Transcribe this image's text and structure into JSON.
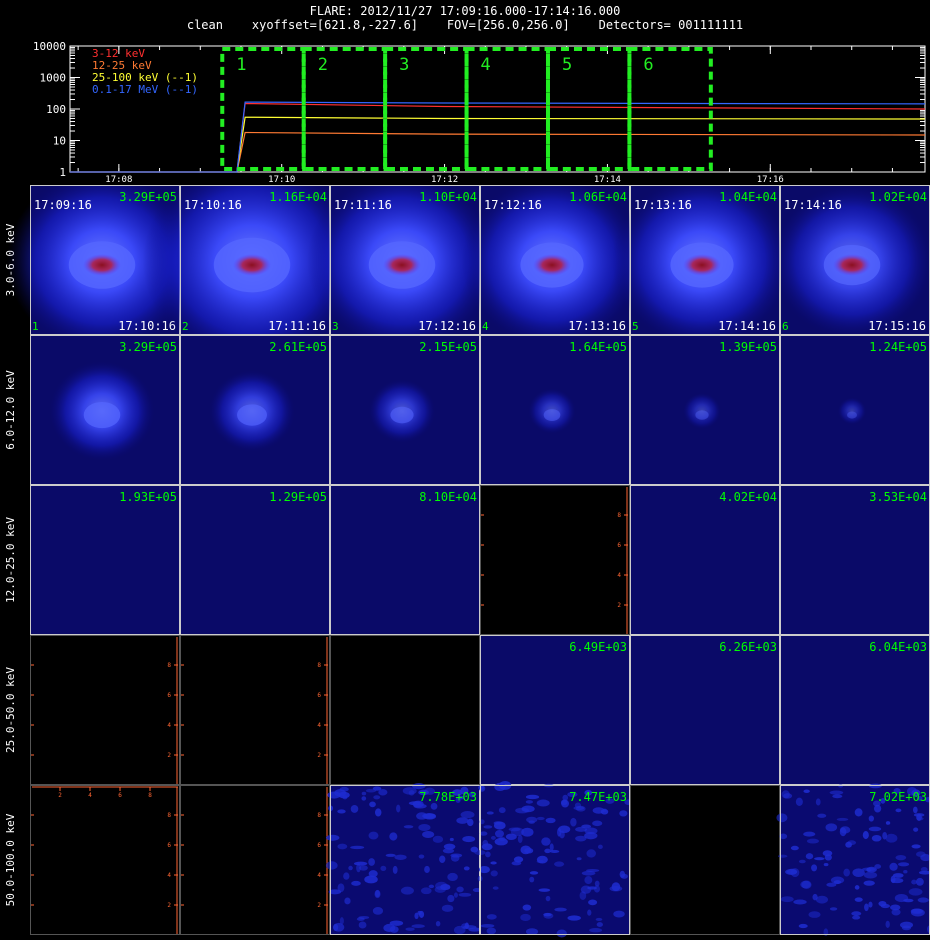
{
  "header": {
    "line1": "FLARE: 2012/11/27 17:09:16.000-17:14:16.000",
    "line2": "clean    xyoffset=[621.8,-227.6]    FOV=[256.0,256.0]    Detectors= 001111111"
  },
  "chart_data": {
    "type": "line",
    "yscale": "log",
    "ylim": [
      1,
      10000
    ],
    "y_ticks": [
      "1",
      "10",
      "100",
      "1000",
      "10000"
    ],
    "x_ticks": [
      "17:08",
      "17:10",
      "17:12",
      "17:14",
      "17:16"
    ],
    "xlim_minutes": [
      7.4,
      17.9
    ],
    "colors": {
      "green": "#00ff00",
      "orange": "#ff6633",
      "box": "#22ee22"
    },
    "series": [
      {
        "name": "3-12 keV",
        "color": "#ff3030",
        "x": [
          7.4,
          9.45,
          9.55,
          12,
          17.9
        ],
        "values": [
          1,
          1,
          150,
          120,
          100
        ]
      },
      {
        "name": "12-25 keV",
        "color": "#ff7a33",
        "x": [
          7.4,
          9.45,
          9.55,
          12,
          17.9
        ],
        "values": [
          1,
          1,
          18,
          16,
          15
        ]
      },
      {
        "name": "25-100 keV (--1)",
        "color": "#ffff33",
        "x": [
          7.4,
          9.45,
          9.55,
          12,
          17.9
        ],
        "values": [
          1,
          1,
          55,
          50,
          48
        ]
      },
      {
        "name": "0.1-17 MeV (--1)",
        "color": "#3366ff",
        "x": [
          7.4,
          9.45,
          9.55,
          12,
          17.9
        ],
        "values": [
          1,
          1,
          165,
          155,
          145
        ]
      }
    ],
    "intervals": [
      {
        "label": "1",
        "x0": 9.27,
        "x1": 10.27
      },
      {
        "label": "2",
        "x0": 10.27,
        "x1": 11.27
      },
      {
        "label": "3",
        "x0": 11.27,
        "x1": 12.27
      },
      {
        "label": "4",
        "x0": 12.27,
        "x1": 13.27
      },
      {
        "label": "5",
        "x0": 13.27,
        "x1": 14.27
      },
      {
        "label": "6",
        "x0": 14.27,
        "x1": 15.27
      }
    ]
  },
  "image_grid": {
    "row_labels": [
      "3.0-6.0 keV",
      "6.0-12.0 keV",
      "12.0-25.0 keV",
      "25.0-50.0 keV",
      "50.0-100.0 keV"
    ],
    "start_times": [
      "17:09:16",
      "17:10:16",
      "17:11:16",
      "17:12:16",
      "17:13:16",
      "17:14:16"
    ],
    "end_times": [
      "17:10:16",
      "17:11:16",
      "17:12:16",
      "17:13:16",
      "17:14:16",
      "17:15:16"
    ],
    "axis_ticks": [
      "2",
      "4",
      "6",
      "8"
    ],
    "cells": [
      [
        {
          "max": "3.29E+05",
          "type": "blob",
          "r": 1.0,
          "i": 1.0,
          "core": true
        },
        {
          "max": "1.16E+04",
          "type": "blob",
          "r": 1.15,
          "i": 1.0,
          "core": true
        },
        {
          "max": "1.10E+04",
          "type": "blob",
          "r": 1.0,
          "i": 1.0,
          "core": true
        },
        {
          "max": "1.06E+04",
          "type": "blob",
          "r": 0.95,
          "i": 1.0,
          "core": true
        },
        {
          "max": "1.04E+04",
          "type": "blob",
          "r": 0.95,
          "i": 1.0,
          "core": true
        },
        {
          "max": "1.02E+04",
          "type": "blob",
          "r": 0.85,
          "i": 0.9,
          "core": true
        }
      ],
      [
        {
          "max": "3.29E+05",
          "type": "blob",
          "r": 0.55,
          "i": 0.9,
          "core": false
        },
        {
          "max": "2.61E+05",
          "type": "blob",
          "r": 0.45,
          "i": 0.8,
          "core": false
        },
        {
          "max": "2.15E+05",
          "type": "blob",
          "r": 0.35,
          "i": 0.7,
          "core": false
        },
        {
          "max": "1.64E+05",
          "type": "blob",
          "r": 0.25,
          "i": 0.6,
          "core": false
        },
        {
          "max": "1.39E+05",
          "type": "blob",
          "r": 0.2,
          "i": 0.5,
          "core": false
        },
        {
          "max": "1.24E+05",
          "type": "blob",
          "r": 0.15,
          "i": 0.45,
          "core": false
        }
      ],
      [
        {
          "max": "1.93E+05",
          "type": "flat"
        },
        {
          "max": "1.29E+05",
          "type": "flat"
        },
        {
          "max": "8.10E+04",
          "type": "flat"
        },
        {
          "max": "",
          "type": "empty",
          "axes": "left"
        },
        {
          "max": "4.02E+04",
          "type": "flat"
        },
        {
          "max": "3.53E+04",
          "type": "flat"
        }
      ],
      [
        {
          "max": "",
          "type": "empty",
          "axes": "left"
        },
        {
          "max": "",
          "type": "empty",
          "axes": "left"
        },
        {
          "max": "",
          "type": "empty",
          "axes": "none"
        },
        {
          "max": "6.49E+03",
          "type": "flat"
        },
        {
          "max": "6.26E+03",
          "type": "flat"
        },
        {
          "max": "6.04E+03",
          "type": "flat"
        }
      ],
      [
        {
          "max": "",
          "type": "empty",
          "axes": "full"
        },
        {
          "max": "",
          "type": "empty",
          "axes": "left"
        },
        {
          "max": "7.78E+03",
          "type": "noise",
          "seed": 3
        },
        {
          "max": "7.47E+03",
          "type": "noise",
          "seed": 7
        },
        {
          "max": "",
          "type": "empty",
          "axes": "none"
        },
        {
          "max": "7.02E+03",
          "type": "noise",
          "seed": 11
        }
      ]
    ]
  }
}
